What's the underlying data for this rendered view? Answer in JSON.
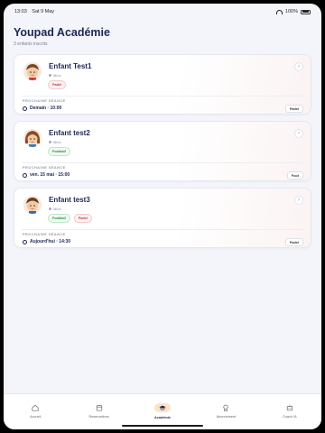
{
  "status": {
    "time": "13:03",
    "date": "Sat 9 May",
    "battery": "100%"
  },
  "header": {
    "title": "Youpad Académie",
    "subtitle": "3 enfants inscrits"
  },
  "children": [
    {
      "name": "Enfant Test1",
      "gender": "Mlos",
      "tags": [
        "Padel"
      ],
      "next_label": "PROCHAINE SÉANCE",
      "next_time": "Demain · 10:00",
      "next_sport": "Padel"
    },
    {
      "name": "Enfant test2",
      "gender": "Mlos",
      "tags": [
        "Football"
      ],
      "next_label": "PROCHAINE SÉANCE",
      "next_time": "ven. 15 mai · 15:00",
      "next_sport": "Foot"
    },
    {
      "name": "Enfant test3",
      "gender": "Mlos",
      "tags": [
        "Football",
        "Padel"
      ],
      "next_label": "PROCHAINE SÉANCE",
      "next_time": "Aujourd'hui · 14:30",
      "next_sport": "Padel"
    }
  ],
  "tabs": [
    {
      "label": "Accueil",
      "icon": "home-icon"
    },
    {
      "label": "Reservations",
      "icon": "calendar-icon"
    },
    {
      "label": "Académie",
      "icon": "graduation-cap-icon",
      "active": true
    },
    {
      "label": "Abonnement",
      "icon": "badge-icon"
    },
    {
      "label": "Coach IA",
      "icon": "robot-icon"
    }
  ],
  "colors": {
    "primary": "#1d2753",
    "accent": "#fbe3c8",
    "padel": "#b3424a",
    "football": "#2f8a48"
  }
}
